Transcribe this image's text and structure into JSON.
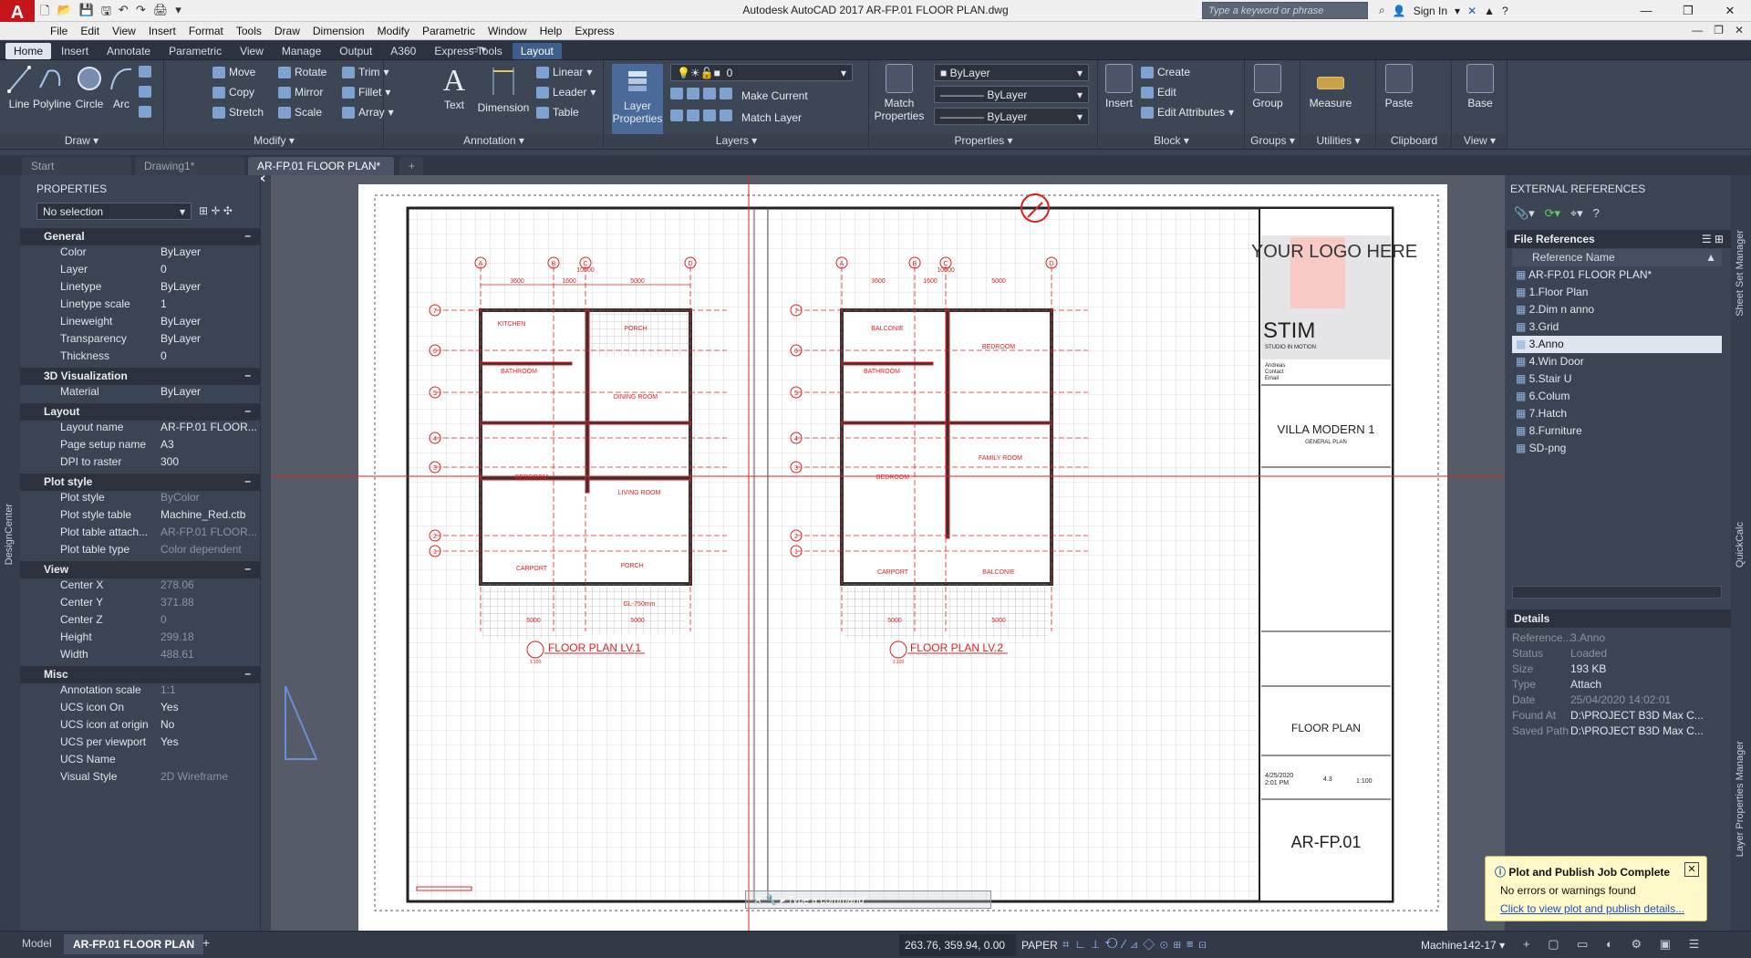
{
  "app": {
    "icon": "A",
    "title": "Autodesk AutoCAD 2017    AR-FP.01 FLOOR PLAN.dwg",
    "search_placeholder": "Type a keyword or phrase",
    "sign_in": "Sign In"
  },
  "menu": [
    "File",
    "Edit",
    "View",
    "Insert",
    "Format",
    "Tools",
    "Draw",
    "Dimension",
    "Modify",
    "Parametric",
    "Window",
    "Help",
    "Express"
  ],
  "ribbon_tabs": [
    "Home",
    "Insert",
    "Annotate",
    "Parametric",
    "View",
    "Manage",
    "Output",
    "A360",
    "Express Tools",
    "Layout"
  ],
  "ribbon": {
    "draw": {
      "title": "Draw",
      "line": "Line",
      "polyline": "Polyline",
      "circle": "Circle",
      "arc": "Arc"
    },
    "modify": {
      "title": "Modify",
      "move": "Move",
      "rotate": "Rotate",
      "trim": "Trim",
      "copy": "Copy",
      "mirror": "Mirror",
      "fillet": "Fillet",
      "stretch": "Stretch",
      "scale": "Scale",
      "array": "Array"
    },
    "annotation": {
      "title": "Annotation",
      "text": "Text",
      "dimension": "Dimension",
      "linear": "Linear",
      "leader": "Leader",
      "table": "Table"
    },
    "layers": {
      "title": "Layers",
      "layer_properties": "Layer Properties",
      "current_layer": "0",
      "make_current": "Make Current",
      "match_layer": "Match Layer"
    },
    "properties": {
      "title": "Properties",
      "match_properties": "Match Properties",
      "color": "ByLayer",
      "linetype": "ByLayer",
      "lineweight": "ByLayer"
    },
    "block": {
      "title": "Block",
      "insert": "Insert",
      "create": "Create",
      "edit": "Edit",
      "edit_attributes": "Edit Attributes"
    },
    "groups": {
      "title": "Groups",
      "group": "Group"
    },
    "utilities": {
      "title": "Utilities",
      "measure": "Measure"
    },
    "clipboard": {
      "title": "Clipboard",
      "paste": "Paste"
    },
    "view": {
      "title": "View",
      "base": "Base"
    }
  },
  "doc_tabs": [
    "Start",
    "Drawing1*",
    "AR-FP.01 FLOOR PLAN*"
  ],
  "properties_panel": {
    "title": "PROPERTIES",
    "selection": "No selection",
    "sections": [
      {
        "name": "General",
        "rows": [
          [
            "Color",
            "ByLayer"
          ],
          [
            "Layer",
            "0"
          ],
          [
            "Linetype",
            "ByLayer"
          ],
          [
            "Linetype scale",
            "1"
          ],
          [
            "Lineweight",
            "ByLayer"
          ],
          [
            "Transparency",
            "ByLayer"
          ],
          [
            "Thickness",
            "0"
          ]
        ]
      },
      {
        "name": "3D Visualization",
        "rows": [
          [
            "Material",
            "ByLayer"
          ]
        ]
      },
      {
        "name": "Layout",
        "rows": [
          [
            "Layout name",
            "AR-FP.01 FLOOR..."
          ],
          [
            "Page setup name",
            "A3"
          ],
          [
            "DPI to raster",
            "300"
          ]
        ]
      },
      {
        "name": "Plot style",
        "rows": [
          [
            "Plot style",
            "ByColor"
          ],
          [
            "Plot style table",
            "Machine_Red.ctb"
          ],
          [
            "Plot table attach...",
            "AR-FP.01 FLOOR..."
          ],
          [
            "Plot table type",
            "Color dependent"
          ]
        ]
      },
      {
        "name": "View",
        "rows": [
          [
            "Center X",
            "278.06"
          ],
          [
            "Center Y",
            "371.88"
          ],
          [
            "Center Z",
            "0"
          ],
          [
            "Height",
            "299.18"
          ],
          [
            "Width",
            "488.61"
          ]
        ]
      },
      {
        "name": "Misc",
        "rows": [
          [
            "Annotation scale",
            "1:1"
          ],
          [
            "UCS icon On",
            "Yes"
          ],
          [
            "UCS icon at origin",
            "No"
          ],
          [
            "UCS per viewport",
            "Yes"
          ],
          [
            "UCS Name",
            ""
          ],
          [
            "Visual Style",
            "2D Wireframe"
          ]
        ]
      }
    ]
  },
  "sheet": {
    "plan1_title": "FLOOR PLAN LV.1",
    "plan2_title": "FLOOR PLAN LV.2",
    "plan_scale": "1:100",
    "grid_letters": [
      "A",
      "B",
      "C",
      "D"
    ],
    "grid_numbers": [
      "7",
      "6",
      "5",
      "4",
      "3",
      "2",
      "1"
    ],
    "dims_top": [
      "3600",
      "1600",
      "5000"
    ],
    "dim_total": "10000",
    "dims_bottom": [
      "5000",
      "5000"
    ],
    "rooms1": [
      "KITCHEN",
      "BATHROOM",
      "PORCH",
      "DINING ROOM",
      "BEDROOM",
      "LIVING ROOM",
      "CARPORT",
      "PORCH"
    ],
    "rooms2": [
      "BALCONIE",
      "BATHROOM",
      "BEDROOM",
      "FAMILY ROOM",
      "BEDROOM",
      "CARPORT",
      "BALCONIE"
    ],
    "logo": "YOUR LOGO HERE",
    "studio": "STIM",
    "studio_sub": "STUDIO IN MOTION",
    "contact": [
      "Andreas",
      "Contact",
      "Email"
    ],
    "project": "VILLA MODERN 1",
    "project_sub": "GENERAL PLAN",
    "drawing_title": "FLOOR PLAN",
    "date": "4/25/2020",
    "time": "2:01 PM",
    "rev": "4.3",
    "scale": "1:100",
    "sheet_no": "AR-FP.01",
    "level_note": "GL-750mm"
  },
  "command_placeholder": "Type a command",
  "xref_panel": {
    "title": "EXTERNAL REFERENCES",
    "file_refs": "File References",
    "col": "Reference Name",
    "items": [
      "AR-FP.01 FLOOR PLAN*",
      "1.Floor Plan",
      "2.Dim n anno",
      "3.Grid",
      "3.Anno",
      "4.Win Door",
      "5.Stair U",
      "6.Colum",
      "7.Hatch",
      "8.Furniture",
      "SD-png"
    ],
    "selected": 4,
    "details_title": "Details",
    "details": [
      [
        "Reference...",
        "3.Anno"
      ],
      [
        "Status",
        "Loaded"
      ],
      [
        "Size",
        "193 KB"
      ],
      [
        "Type",
        "Attach"
      ],
      [
        "Date",
        "25/04/2020 14:02:01"
      ],
      [
        "Found At",
        "D:\\PROJECT B3D Max C..."
      ],
      [
        "Saved Path",
        "D:\\PROJECT B3D Max C..."
      ]
    ]
  },
  "side_labels": {
    "design_center": "DesignCenter",
    "sheet_set": "Sheet Set Manager",
    "quickcalc": "QuickCalc",
    "layer_props": "Layer Properties Manager"
  },
  "notification": {
    "title": "Plot and Publish Job Complete",
    "body": "No errors or warnings found",
    "link": "Click to view plot and publish details..."
  },
  "layout_tabs": [
    "Model",
    "AR-FP.01 FLOOR PLAN"
  ],
  "status": {
    "coords": "263.76, 359.94, 0.00",
    "space": "PAPER",
    "machine": "Machine142-17"
  },
  "colors": {
    "accent": "#3e5e8c",
    "drawing_red": "#e02020",
    "notif_bg": "#fff8c8"
  }
}
